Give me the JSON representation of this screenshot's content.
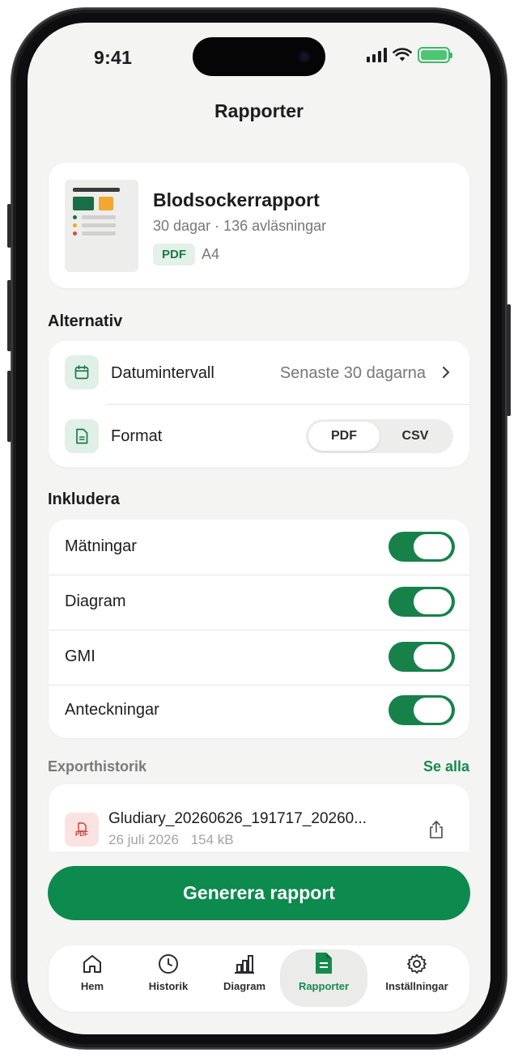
{
  "status_bar": {
    "time": "9:41"
  },
  "header": {
    "title": "Rapporter"
  },
  "report_card": {
    "title": "Blodsockerrapport",
    "subtitle": "30 dagar · 136 avläsningar",
    "format_badge": "PDF",
    "paper_size": "A4"
  },
  "options": {
    "section_title": "Alternativ",
    "date_range_label": "Datumintervall",
    "date_range_value": "Senaste 30 dagarna",
    "format_label": "Format",
    "format_options": [
      "PDF",
      "CSV"
    ],
    "format_selected": "PDF"
  },
  "include": {
    "section_title": "Inkludera",
    "items": [
      {
        "label": "Mätningar",
        "enabled": true
      },
      {
        "label": "Diagram",
        "enabled": true
      },
      {
        "label": "GMI",
        "enabled": true
      },
      {
        "label": "Anteckningar",
        "enabled": true
      }
    ]
  },
  "export_history": {
    "section_title": "Exporthistorik",
    "see_all": "Se alla",
    "items": [
      {
        "file_name": "Gludiary_20260626_191717_20260...",
        "date": "26 juli 2026",
        "size": "154 kB",
        "icon_text": "PDF"
      }
    ]
  },
  "generate_button": "Generera rapport",
  "tab_bar": {
    "tabs": [
      {
        "label": "Hem",
        "icon": "home-icon"
      },
      {
        "label": "Historik",
        "icon": "clock-icon"
      },
      {
        "label": "Diagram",
        "icon": "bar-chart-icon"
      },
      {
        "label": "Rapporter",
        "icon": "document-icon"
      },
      {
        "label": "Inställningar",
        "icon": "gear-icon"
      }
    ],
    "active": "Rapporter"
  },
  "colors": {
    "accent": "#0d8a4d",
    "toggle_on": "#16824a",
    "background": "#f4f4f2",
    "pdf_red": "#d03a32"
  }
}
